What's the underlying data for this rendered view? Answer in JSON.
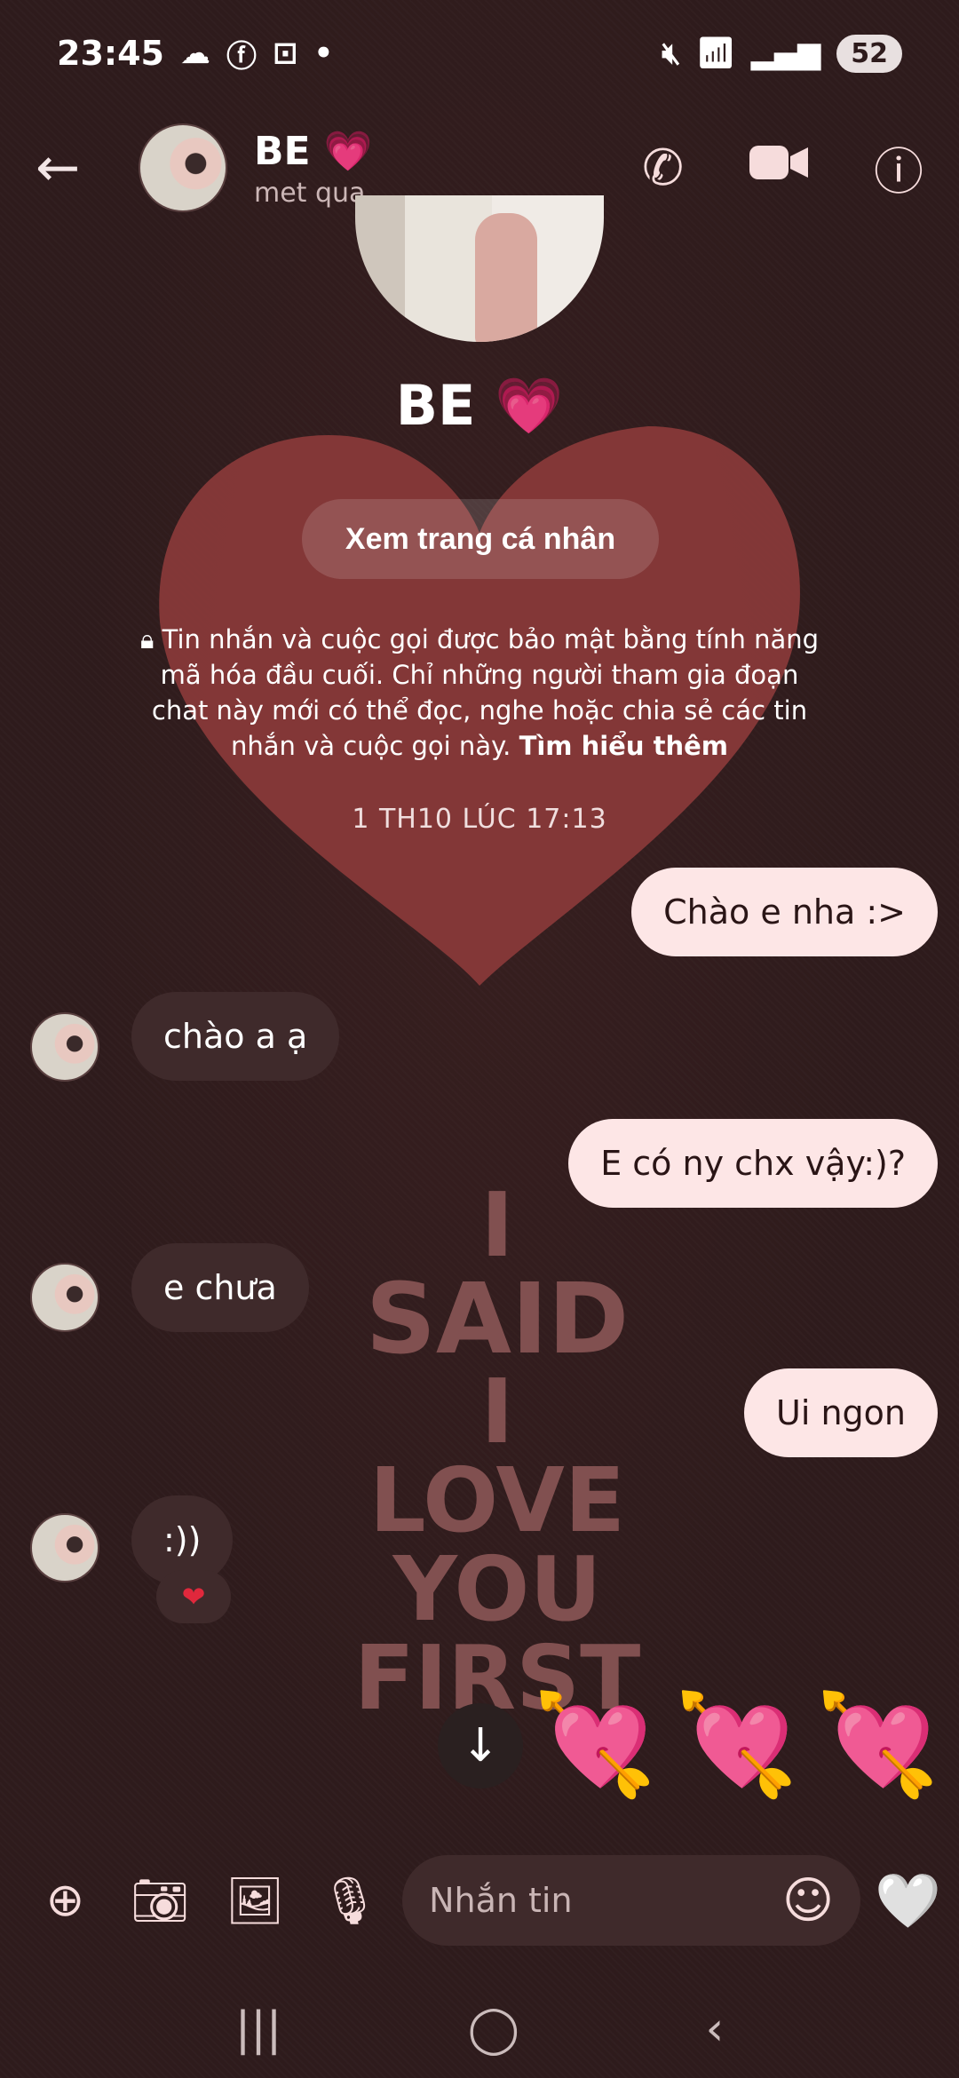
{
  "status_bar": {
    "time": "23:45",
    "battery": "52",
    "left_icons": [
      "cloud-icon",
      "facebook-icon",
      "screenshot-icon",
      "dot-icon"
    ],
    "right_icons": [
      "mute-icon",
      "wifi-icon",
      "signal-icon"
    ]
  },
  "header": {
    "name": "BE",
    "name_emoji": "💗",
    "status": "met qua"
  },
  "profile": {
    "name": "BE",
    "name_emoji": "💗",
    "view_profile_label": "Xem trang cá nhân",
    "encryption_text": "Tin nhắn và cuộc gọi được bảo mật bằng tính năng mã hóa đầu cuối. Chỉ những người tham gia đoạn chat này mới có thể đọc, nghe hoặc chia sẻ các tin nhắn và cuộc gọi này.",
    "learn_more": "Tìm hiểu thêm",
    "date": "1 TH10 LÚC 17:13"
  },
  "messages": [
    {
      "direction": "out",
      "text": "Chào e nha :>"
    },
    {
      "direction": "in",
      "text": "chào a ạ"
    },
    {
      "direction": "out",
      "text": "E có ny chx vậy:)?"
    },
    {
      "direction": "in",
      "text": "e chưa"
    },
    {
      "direction": "out",
      "text": "Ui ngon"
    },
    {
      "direction": "in",
      "text": ":))",
      "reaction": "❤"
    }
  ],
  "background_art": [
    "I",
    "SAID",
    "I",
    "LOVE",
    "YOU",
    "FIRST"
  ],
  "arrow_hearts": [
    "💘",
    "💘",
    "💘"
  ],
  "composer": {
    "placeholder": "Nhắn tin",
    "like": "🤍"
  }
}
